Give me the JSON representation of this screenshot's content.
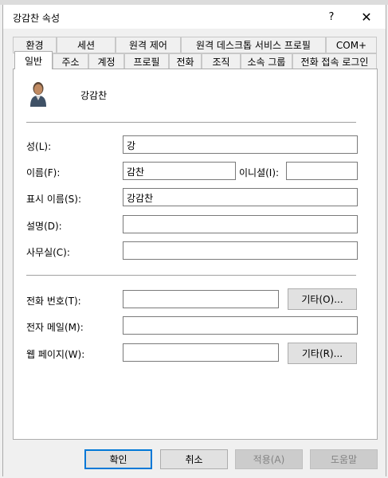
{
  "window": {
    "title": "강감찬 속성",
    "help_label": "?",
    "close_label": "✕"
  },
  "tabs": {
    "row1": [
      "환경",
      "세션",
      "원격 제어",
      "원격 데스크톱 서비스 프로필",
      "COM+"
    ],
    "row2": [
      "일반",
      "주소",
      "계정",
      "프로필",
      "전화",
      "조직",
      "소속 그룹",
      "전화 접속 로그인"
    ],
    "active": "일반"
  },
  "general": {
    "display_name_header": "강감찬",
    "last_name_label": "성(L):",
    "last_name_value": "강",
    "first_name_label": "이름(F):",
    "first_name_value": "감찬",
    "initials_label": "이니셜(I):",
    "initials_value": "",
    "display_name_label": "표시 이름(S):",
    "display_name_value": "강감찬",
    "description_label": "설명(D):",
    "description_value": "",
    "office_label": "사무실(C):",
    "office_value": "",
    "phone_label": "전화 번호(T):",
    "phone_value": "",
    "phone_other_button": "기타(O)...",
    "email_label": "전자 메일(M):",
    "email_value": "",
    "webpage_label": "웹 페이지(W):",
    "webpage_value": "",
    "webpage_other_button": "기타(R)..."
  },
  "footer": {
    "ok": "확인",
    "cancel": "취소",
    "apply": "적용(A)",
    "help": "도움말"
  },
  "colors": {
    "accent": "#0078d7",
    "dialog_bg": "#f0f0f0",
    "panel_bg": "#ffffff"
  }
}
